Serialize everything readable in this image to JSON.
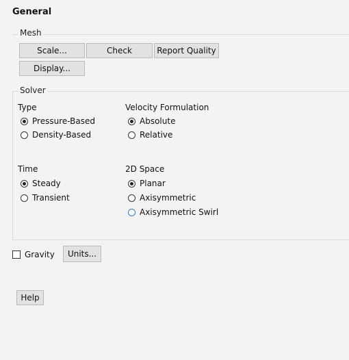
{
  "panel": {
    "title": "General"
  },
  "mesh": {
    "label": "Mesh",
    "scale_button": "Scale...",
    "check_button": "Check",
    "report_quality_button": "Report Quality",
    "display_button": "Display..."
  },
  "solver": {
    "label": "Solver",
    "type": {
      "heading": "Type",
      "options": [
        {
          "label": "Pressure-Based",
          "selected": true
        },
        {
          "label": "Density-Based",
          "selected": false
        }
      ]
    },
    "velocity_formulation": {
      "heading": "Velocity Formulation",
      "options": [
        {
          "label": "Absolute",
          "selected": true
        },
        {
          "label": "Relative",
          "selected": false
        }
      ]
    },
    "time": {
      "heading": "Time",
      "options": [
        {
          "label": "Steady",
          "selected": true
        },
        {
          "label": "Transient",
          "selected": false
        }
      ]
    },
    "space_2d": {
      "heading": "2D Space",
      "options": [
        {
          "label": "Planar",
          "selected": true
        },
        {
          "label": "Axisymmetric",
          "selected": false
        },
        {
          "label": "Axisymmetric Swirl",
          "selected": false
        }
      ]
    }
  },
  "gravity": {
    "label": "Gravity",
    "checked": false
  },
  "units_button": "Units...",
  "help_button": "Help"
}
